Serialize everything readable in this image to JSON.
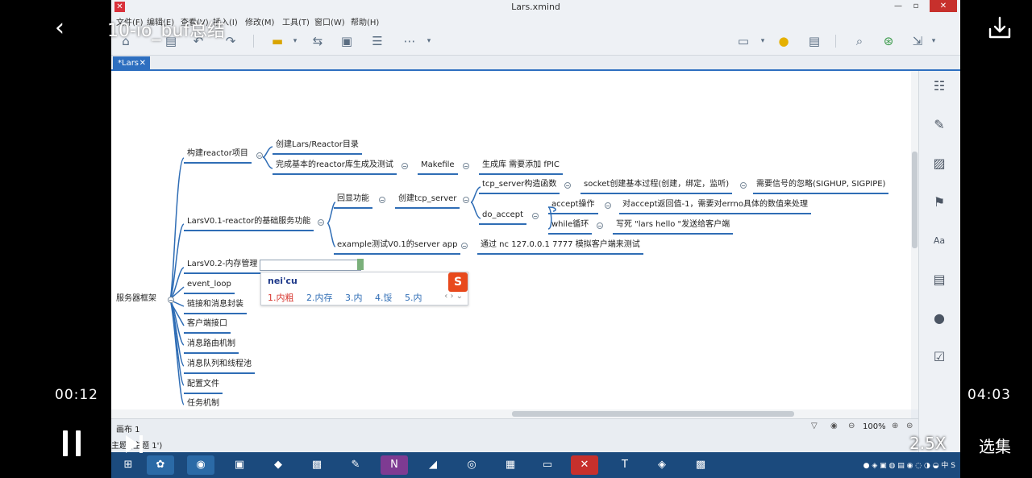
{
  "player": {
    "title": "10-io_buf总结",
    "current_time": "00:12",
    "total_time": "04:03",
    "speed": "2.5X",
    "episodes_label": "选集"
  },
  "app": {
    "window_title": "Lars.xmind",
    "menu": [
      "文件(F)",
      "编辑(E)",
      "查看(V)",
      "插入(I)",
      "修改(M)",
      "工具(T)",
      "窗口(W)",
      "帮助(H)"
    ],
    "tab_label": "*Lars",
    "canvas_label": "画布 1",
    "zoom": "100%",
    "topic_status": "主题 (主题 1')"
  },
  "mindmap": {
    "root": "服务器框架",
    "branches": [
      "构建reactor项目",
      "LarsV0.1-reactor的基础服务功能",
      "LarsV0.2-内存管理",
      "event_loop",
      "链接和消息封装",
      "客户端接口",
      "消息路由机制",
      "消息队列和线程池",
      "配置文件",
      "任务机制"
    ],
    "reactor_children": [
      "创建Lars/Reactor目录",
      "完成基本的reactor库生成及测试"
    ],
    "makefile": "Makefile",
    "makefile_note": "生成库 需要添加 fPIC",
    "echo": "回显功能",
    "create_server": "创建tcp_server",
    "tcp_ctor": "tcp_server构造函数",
    "socket_steps": "socket创建基本过程(创建，绑定，监听)",
    "signal_ignore": "需要信号的忽略(SIGHUP, SIGPIPE)",
    "do_accept": "do_accept",
    "accept_op": "accept操作",
    "accept_err": "对accept返回值-1，需要对errno具体的数值来处理",
    "while_loop": "while循环",
    "write_hello": "写死 \"lars hello \"发送给客户端",
    "example": "example测试V0.1的server app",
    "nc_test": "通过 nc 127.0.0.1 7777 模拟客户端来测试"
  },
  "ime": {
    "input": "nei'cu",
    "logo": "S",
    "candidates": [
      "1.内粗",
      "2.内存",
      "3.内",
      "4.馁",
      "5.内"
    ]
  }
}
